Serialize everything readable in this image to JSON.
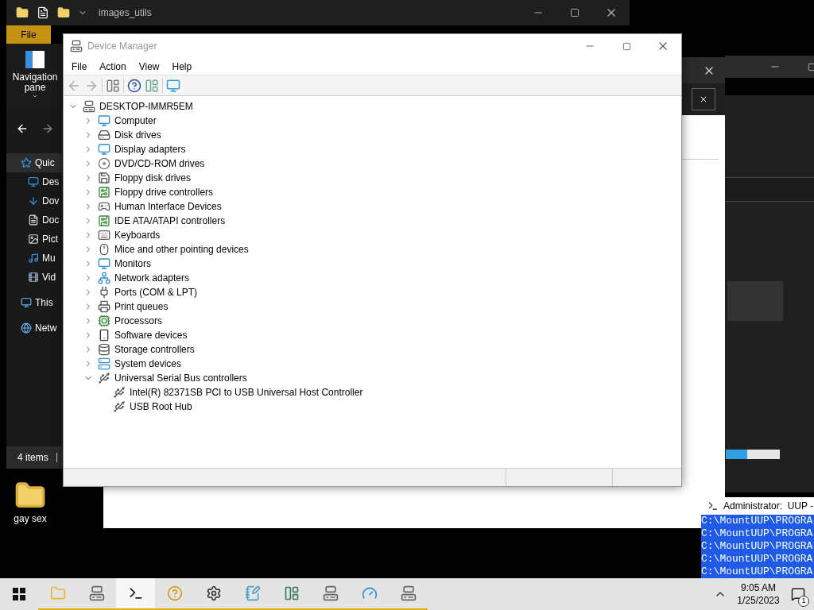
{
  "explorer": {
    "title": "images_utils",
    "ribbon_tabs": [
      {
        "label": "File",
        "selected": true
      }
    ],
    "navigation_pane": "Navigation pane",
    "nav": [
      {
        "label": "Quic",
        "selected": true
      },
      {
        "label": "Des",
        "selected": false
      },
      {
        "label": "Dov",
        "selected": false
      },
      {
        "label": "Doc",
        "selected": false
      },
      {
        "label": "Pict",
        "selected": false
      },
      {
        "label": "Mu",
        "selected": false
      },
      {
        "label": "Vid",
        "selected": false
      },
      {
        "label": "This",
        "selected": false
      },
      {
        "label": "Netw",
        "selected": false
      }
    ],
    "status": "4 items"
  },
  "desktop_icons": [
    {
      "label": "gay sex"
    }
  ],
  "device_manager": {
    "title": "Device Manager",
    "active": false,
    "menu": [
      "File",
      "Action",
      "View",
      "Help"
    ],
    "tree": {
      "label": "DESKTOP-IMMR5EM",
      "expanded": true,
      "children": [
        {
          "label": "Computer",
          "expanded": false
        },
        {
          "label": "Disk drives",
          "expanded": false
        },
        {
          "label": "Display adapters",
          "expanded": false
        },
        {
          "label": "DVD/CD-ROM drives",
          "expanded": false
        },
        {
          "label": "Floppy disk drives",
          "expanded": false
        },
        {
          "label": "Floppy drive controllers",
          "expanded": false
        },
        {
          "label": "Human Interface Devices",
          "expanded": false
        },
        {
          "label": "IDE ATA/ATAPI controllers",
          "expanded": false
        },
        {
          "label": "Keyboards",
          "expanded": false
        },
        {
          "label": "Mice and other pointing devices",
          "expanded": false
        },
        {
          "label": "Monitors",
          "expanded": false
        },
        {
          "label": "Network adapters",
          "expanded": false
        },
        {
          "label": "Ports (COM & LPT)",
          "expanded": false
        },
        {
          "label": "Print queues",
          "expanded": false
        },
        {
          "label": "Processors",
          "expanded": false
        },
        {
          "label": "Software devices",
          "expanded": false
        },
        {
          "label": "Storage controllers",
          "expanded": false
        },
        {
          "label": "System devices",
          "expanded": false
        },
        {
          "label": "Universal Serial Bus controllers",
          "expanded": true,
          "children": [
            {
              "label": "Intel(R) 82371SB PCI to USB Universal Host Controller"
            },
            {
              "label": "USB Root Hub"
            }
          ]
        }
      ]
    }
  },
  "progress": {
    "level": 0.4
  },
  "console": {
    "title": "Administrator:  UUP -",
    "lines": [
      "C:\\MountUUP\\PROGRA",
      "C:\\MountUUP\\PROGRA",
      "C:\\MountUUP\\PROGRA",
      "C:\\MountUUP\\PROGRA",
      "C:\\MountUUP\\PROGRA"
    ]
  },
  "taskbar": {
    "apps": [
      {
        "selected": false
      },
      {
        "selected": false
      },
      {
        "selected": true
      },
      {
        "selected": false
      },
      {
        "selected": false
      },
      {
        "selected": false
      },
      {
        "selected": false
      },
      {
        "selected": false
      },
      {
        "selected": false
      },
      {
        "selected": false
      }
    ],
    "time": "9:05 AM",
    "date": "1/25/2023",
    "notifications": "1"
  }
}
